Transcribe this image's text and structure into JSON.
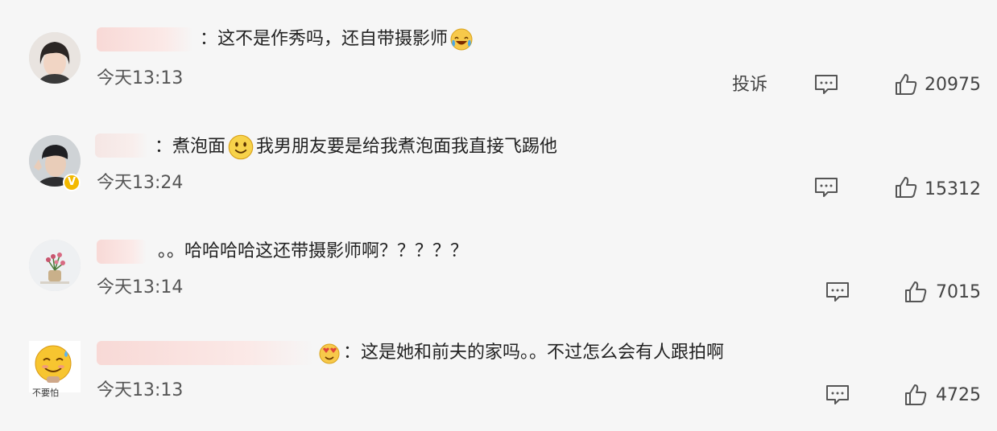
{
  "comments": [
    {
      "text_before": "：这不是作秀吗，还自带摄影师",
      "text_after": "",
      "time": "今天13:13",
      "report_label": "投诉",
      "likes": "20975",
      "emoji_name": "laugh-cry-emoji"
    },
    {
      "text_before": "：煮泡面",
      "text_after": "我男朋友要是给我煮泡面我直接飞踢他",
      "time": "今天13:24",
      "likes": "15312",
      "emoji_name": "smile-emoji"
    },
    {
      "text_before": "。。哈哈哈哈这还带摄影师啊？？？？？",
      "text_after": "",
      "time": "今天13:14",
      "likes": "7015"
    },
    {
      "text_before": "：这是她和前夫的家吗。。不过怎么会有人跟拍啊",
      "text_after": "",
      "time": "今天13:13",
      "likes": "4725",
      "avatar_text": "不要怕"
    }
  ],
  "colors": {
    "background": "#f6f6f6",
    "name_blur": "#f8d9d6",
    "verified_badge": "#f3b900"
  }
}
